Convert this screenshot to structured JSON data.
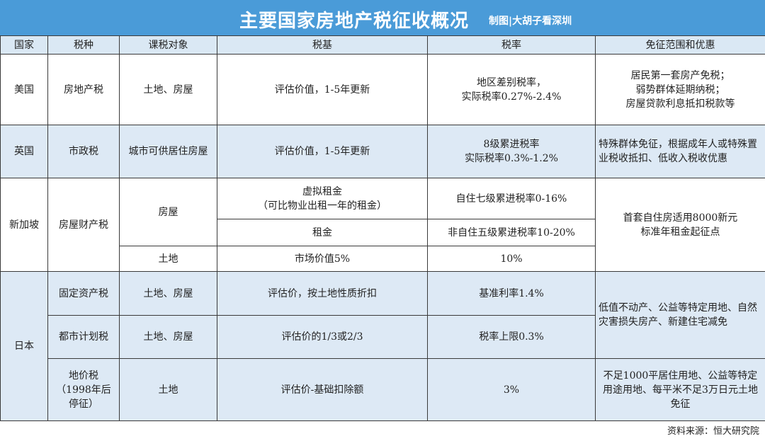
{
  "title": "主要国家房地产税征收概况",
  "credit": "制图|大胡子看深圳",
  "headers": {
    "country": "国家",
    "tax": "税种",
    "object": "课税对象",
    "base": "税基",
    "rate": "税率",
    "exemption": "免征范围和优惠"
  },
  "rows": {
    "us": {
      "country": "美国",
      "tax": "房地产税",
      "object": "土地、房屋",
      "base": "评估价值，1-5年更新",
      "rate": "地区差别税率，\n实际税率0.27%-2.4%",
      "exemption": "居民第一套房产免税；\n弱势群体延期纳税；\n房屋贷款利息抵扣税款等"
    },
    "uk": {
      "country": "英国",
      "tax": "市政税",
      "object": "城市可供居住房屋",
      "base": "评估价值，1-5年更新",
      "rate": "8级累进税率\n实际税率0.3%-1.2%",
      "exemption": "特殊群体免征，根据成年人或特殊置业税收抵扣、低收入税收优惠"
    },
    "sg": {
      "country": "新加坡",
      "tax": "房屋财产税",
      "object_house": "房屋",
      "base_virtual": "虚拟租金\n（可比物业出租一年的租金）",
      "rate_self": "自住七级累进税率0-16%",
      "base_rent": "租金",
      "rate_nonself": "非自住五级累进税率10-20%",
      "object_land": "土地",
      "base_land": "市场价值5%",
      "rate_land": "10%",
      "exemption": "首套自住房适用8000新元\n标准年租金起征点"
    },
    "jp": {
      "country": "日本",
      "fixed": {
        "tax": "固定资产税",
        "object": "土地、房屋",
        "base": "评估价，按土地性质折扣",
        "rate": "基准利率1.4%"
      },
      "urban": {
        "tax": "都市计划税",
        "object": "土地、房屋",
        "base": "评估价的1/3或2/3",
        "rate": "税率上限0.3%"
      },
      "land": {
        "tax": "地价税\n（1998年后\n停征）",
        "object": "土地",
        "base": "评估价-基础扣除额",
        "rate": "3%",
        "exemption": "不足1000平居住用地、公益等特定\n用途用地、每平米不足3万日元土地免征"
      },
      "exemption_fixed_urban": "低值不动产、公益等特定用地、自然灾害损失房产、新建住宅减免"
    }
  },
  "source": "资料来源：恒大研究院"
}
